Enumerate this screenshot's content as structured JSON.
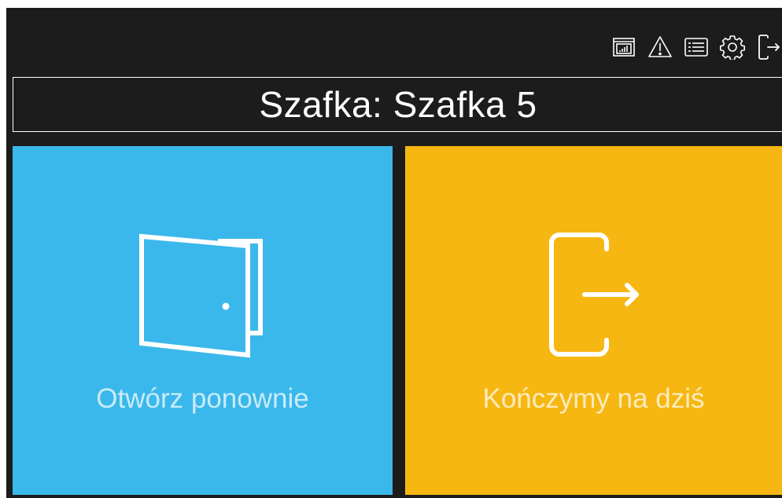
{
  "colors": {
    "background": "#1c1c1c",
    "reopen_tile": "#3bb8eb",
    "finish_tile": "#f7b712",
    "text": "#ffffff"
  },
  "toolbar": {
    "items": [
      {
        "icon": "stats-report-icon"
      },
      {
        "icon": "warning-icon"
      },
      {
        "icon": "list-icon"
      },
      {
        "icon": "gear-icon"
      },
      {
        "icon": "logout-icon"
      }
    ]
  },
  "header": {
    "title": "Szafka: Szafka 5"
  },
  "tiles": {
    "reopen": {
      "label": "Otwórz ponownie",
      "icon": "door-icon"
    },
    "finish": {
      "label": "Kończymy na dziś",
      "icon": "exit-icon"
    }
  }
}
